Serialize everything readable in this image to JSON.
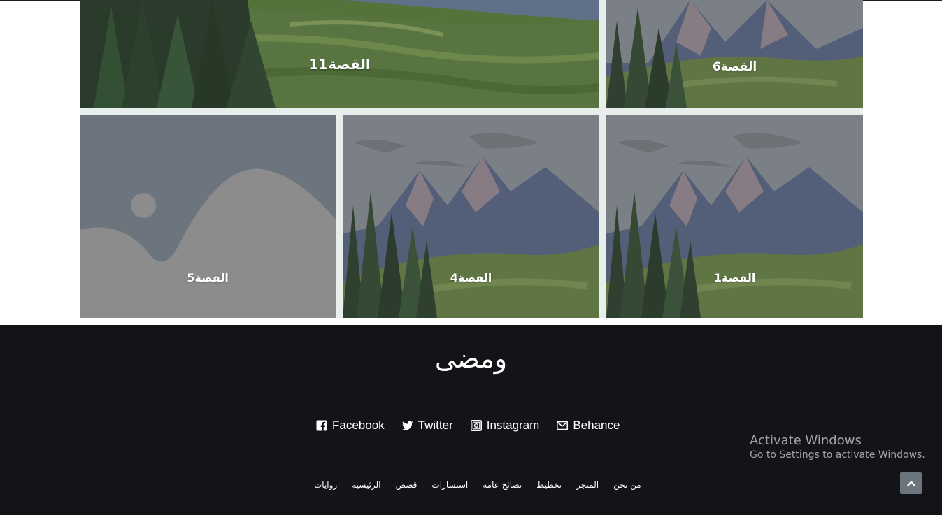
{
  "gallery": {
    "stories": [
      {
        "label": "القصة11",
        "image": "mountain-landscape"
      },
      {
        "label": "القصة6",
        "image": "mountain-landscape"
      },
      {
        "label": "القصة5",
        "image": "image-placeholder"
      },
      {
        "label": "القصة4",
        "image": "mountain-landscape"
      },
      {
        "label": "القصة1",
        "image": "mountain-landscape"
      }
    ]
  },
  "footer": {
    "brand": "ومضى",
    "social": [
      {
        "label": "Facebook",
        "icon": "facebook-icon"
      },
      {
        "label": "Twitter",
        "icon": "twitter-icon"
      },
      {
        "label": "Instagram",
        "icon": "instagram-icon"
      },
      {
        "label": "Behance",
        "icon": "mail-icon"
      }
    ],
    "nav": [
      "روايات",
      "الرئيسية",
      "قصص",
      "استشارات",
      "نصائح عامة",
      "تخطيط",
      "المتجر",
      "من نحن"
    ]
  },
  "watermark": {
    "title": "Activate Windows",
    "subtitle": "Go to Settings to activate Windows."
  },
  "back_to_top": {
    "icon": "chevron-up-icon"
  },
  "colors": {
    "footer_bg": "#131418",
    "grid_gap": "#e7eeeb",
    "back_to_top_bg": "#6c757d"
  }
}
